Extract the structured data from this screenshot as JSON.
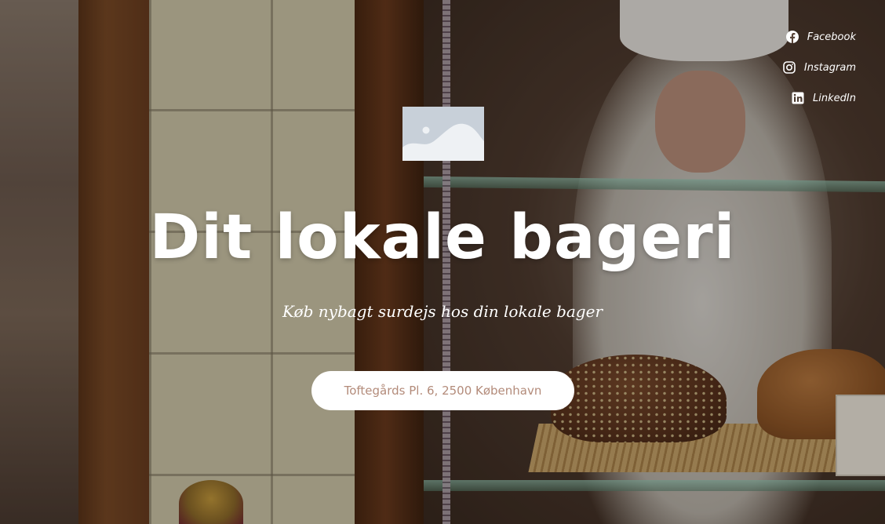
{
  "social": [
    {
      "label": "Facebook",
      "icon": "facebook-icon"
    },
    {
      "label": "Instagram",
      "icon": "instagram-icon"
    },
    {
      "label": "LinkedIn",
      "icon": "linkedin-icon"
    }
  ],
  "logo": {
    "icon": "image-placeholder-icon"
  },
  "hero": {
    "title": "Dit lokale bageri",
    "subtitle": "Køb nybagt surdejs hos din lokale bager",
    "address": "Toftegårds Pl. 6, 2500 København"
  },
  "colors": {
    "text": "#ffffff",
    "button_bg": "#ffffff",
    "button_text": "#b38b7a",
    "logo_placeholder": "#c8d0d9"
  }
}
